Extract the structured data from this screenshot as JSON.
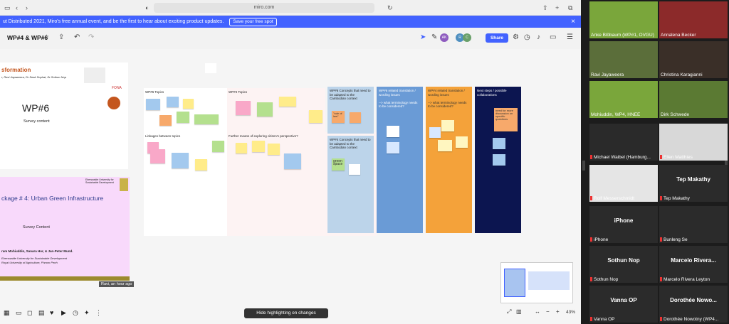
{
  "browser": {
    "url": "miro.com"
  },
  "banner": {
    "text": "ut Distributed 2021, Miro's free annual event, and be the first to hear about exciting product updates.",
    "button": "Save your free spot",
    "close": "×"
  },
  "topbar": {
    "board_title": "WP#4 & WP#6",
    "share": "Share",
    "avatars": [
      "AK",
      "R",
      "C"
    ]
  },
  "wp6_card": {
    "transformation": "sformation",
    "authors": "r, Ravi Jayaweera, Dr Seak Sophat, Dr Sothun Nop",
    "title": "WP#6",
    "subtitle": "Survey content",
    "fona": "FONA"
  },
  "wp4_card": {
    "title": "ckage # 4: Urban Green Infrastructure",
    "subtitle": "Survey Content",
    "authors": "ram Mohiuddin, Sanara Hor, & Jan-Peter Mund.",
    "aff1": "Eberswalde University for Sustainable Development",
    "aff2": "Royal University of Agriculture, Phnom Penh",
    "uni": "Eberswalde University for Sustainable Development"
  },
  "board": {
    "wp6_topics": "WP#6 Topics",
    "wp4_topics": "WP#4 Topics",
    "linkages": "Linkages between topics",
    "further": "Further means of exploring citizen's perspective?",
    "wp6_concepts": "WP#6 Concepts that need to be adapted to the Cambodian context",
    "wp6_translation": "WP#6 related translation / wording issues\n\n--> what terminology needs to be considered?",
    "wp4_translation": "WP#4 related translation / wording issues\n\n--> what terminology needs to be considered?",
    "next_steps": "Next steps / possible collaborations",
    "wp4_concepts": "WP#4 Concepts that need to be adapted to the Cambodian context",
    "green_space": "green space",
    "rule_of_law": "\"rule of law\"",
    "more_discussion": "need for more discussion on specific questions"
  },
  "canvas": {
    "ravi_tag": "Ravi, an hour ago",
    "hide_highlight": "Hide highlighting on changes",
    "zoom": "43%"
  },
  "participants": [
    {
      "name": "Anke Blöbaum (WP#1, OVGU)",
      "bg": "#7aa63b"
    },
    {
      "name": "Annalena Becker",
      "bg": "#8c2a2a"
    },
    {
      "name": "Ravi Jayaweera",
      "bg": "#5b6e3a"
    },
    {
      "name": "Christina Karagianni",
      "bg": "#3a2f28"
    },
    {
      "name": "Mohiuddin, WP4, HNEE",
      "bg": "#7aa63b"
    },
    {
      "name": "Dirk Schwede",
      "bg": "#5b7a33"
    },
    {
      "name": "Michael Waibel (Hamburg...",
      "bg": "#2a2a2a"
    },
    {
      "name": "Ellen Matthies",
      "bg": "#d8d8d8"
    },
    {
      "name": "Rolf Messerschmidt",
      "bg": "#e5e5e5"
    },
    {
      "name": "Tep Makathy",
      "bg": "#2b2b2b",
      "big": "Tep Makathy"
    },
    {
      "name": "iPhone",
      "bg": "#2b2b2b",
      "big": "iPhone"
    },
    {
      "name": "Bunleng Se",
      "bg": "#2b2b2b"
    },
    {
      "name": "Sothun Nop",
      "bg": "#2b2b2b",
      "big": "Sothun Nop"
    },
    {
      "name": "Marcelo Rivera Leyton",
      "bg": "#2b2b2b",
      "big": "Marcelo Rivera..."
    },
    {
      "name": "Vanna OP",
      "bg": "#2b2b2b",
      "big": "Vanna OP"
    },
    {
      "name": "Dorothée Nowotny (WP4...",
      "bg": "#2b2b2b",
      "big": "Dorothée Nowo..."
    }
  ]
}
